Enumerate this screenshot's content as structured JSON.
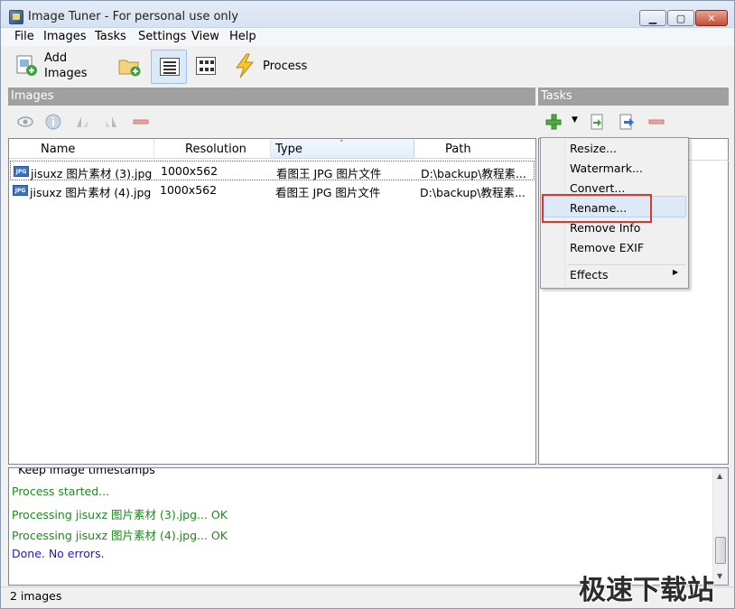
{
  "window": {
    "title": "Image Tuner - For personal use only"
  },
  "menu": [
    "File",
    "Images",
    "Tasks",
    "Settings",
    "View",
    "Help"
  ],
  "toolbar": {
    "add_images_line1": "Add",
    "add_images_line2": "Images",
    "process_label": "Process"
  },
  "images_panel": {
    "header": "Images",
    "columns": [
      "Name",
      "Resolution",
      "Type",
      "Path"
    ],
    "rows": [
      {
        "icon": "JPG",
        "name": "jisuxz 图片素材 (3).jpg",
        "resolution": "1000x562",
        "type": "看图王 JPG 图片文件",
        "path": "D:\\backup\\教程素..."
      },
      {
        "icon": "JPG",
        "name": "jisuxz 图片素材 (4).jpg",
        "resolution": "1000x562",
        "type": "看图王 JPG 图片文件",
        "path": "D:\\backup\\教程素..."
      }
    ]
  },
  "tasks_panel": {
    "header": "Tasks",
    "context_menu": [
      "Resize...",
      "Watermark...",
      "Convert...",
      "Rename...",
      "Remove Info",
      "Remove EXIF",
      "Effects"
    ],
    "highlighted": "Rename..."
  },
  "log": {
    "lines": [
      {
        "text": "Keep image timestamps",
        "color": "#000000"
      },
      {
        "text": "Process started...",
        "color": "#1f8a1f"
      },
      {
        "text": "Processing jisuxz 图片素材 (3).jpg... OK",
        "color": "#1f8a1f"
      },
      {
        "text": "Processing jisuxz 图片素材 (4).jpg... OK",
        "color": "#1f8a1f"
      },
      {
        "text": "Done. No errors.",
        "color": "#1a1ad0"
      }
    ]
  },
  "status": {
    "text": "2 images"
  },
  "watermark": "极速下载站",
  "colors": {
    "section_header": "#a0a0a0",
    "highlight_box": "#d43a2f",
    "log_green": "#1f8a1f",
    "log_blue": "#1a1ad0"
  }
}
